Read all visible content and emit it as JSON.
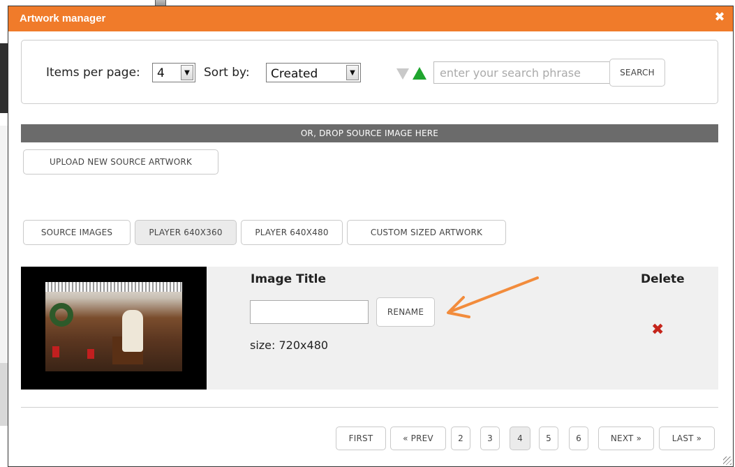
{
  "dialog": {
    "title": "Artwork manager",
    "close_glyph": "✖",
    "accent_color": "#f07b2a"
  },
  "toolbar": {
    "items_per_page_label": "Items per page:",
    "items_per_page_value": "4",
    "sort_by_label": "Sort by:",
    "sort_by_value": "Created",
    "sort_desc_icon": "triangle-down-icon",
    "sort_asc_icon": "triangle-up-icon",
    "search_placeholder": "enter your search phrase",
    "search_button": "SEARCH"
  },
  "dropzone": {
    "label": "OR, DROP SOURCE IMAGE HERE"
  },
  "upload_button": "UPLOAD NEW SOURCE ARTWORK",
  "tabs": [
    {
      "label": "SOURCE IMAGES",
      "active": false
    },
    {
      "label": "PLAYER 640X360",
      "active": true
    },
    {
      "label": "PLAYER 640X480",
      "active": false
    },
    {
      "label": "CUSTOM SIZED ARTWORK",
      "active": false
    }
  ],
  "item": {
    "title_header": "Image Title",
    "delete_header": "Delete",
    "title_value": "",
    "rename_button": "RENAME",
    "size_text": "size: 720x480",
    "delete_glyph": "✖"
  },
  "pagination": {
    "first": "FIRST",
    "prev": "« PREV",
    "pages": [
      "2",
      "3",
      "4",
      "5",
      "6"
    ],
    "current": "4",
    "next": "NEXT »",
    "last": "LAST »"
  }
}
